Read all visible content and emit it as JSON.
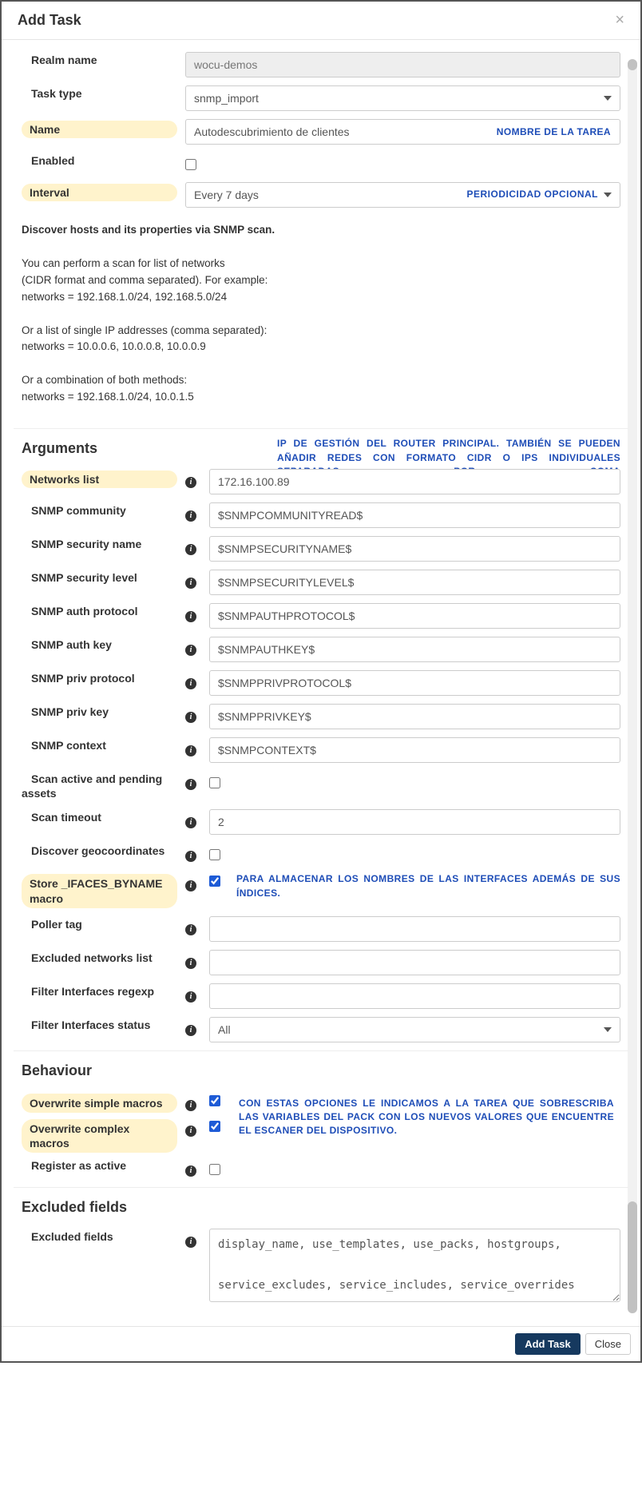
{
  "modal": {
    "title": "Add Task",
    "close": "×"
  },
  "fields": {
    "realm_name": {
      "label": "Realm name",
      "value": "wocu-demos"
    },
    "task_type": {
      "label": "Task type",
      "value": "snmp_import"
    },
    "name": {
      "label": "Name",
      "value": "Autodescubrimiento de clientes",
      "annotation": "NOMBRE DE LA TAREA"
    },
    "enabled": {
      "label": "Enabled"
    },
    "interval": {
      "label": "Interval",
      "value": "Every 7 days",
      "annotation": "PERIODICIDAD OPCIONAL"
    }
  },
  "description": {
    "heading": "Discover hosts and its properties via SNMP scan.",
    "p1a": "You can perform a scan for list of networks",
    "p1b": "(CIDR format and comma separated). For example:",
    "p1c": "networks = 192.168.1.0/24, 192.168.5.0/24",
    "p2a": "Or a list of single IP addresses (comma separated):",
    "p2b": "networks = 10.0.0.6, 10.0.0.8, 10.0.0.9",
    "p3a": "Or a combination of both methods:",
    "p3b": "networks = 192.168.1.0/24, 10.0.1.5"
  },
  "sections": {
    "arguments": "Arguments",
    "behaviour": "Behaviour",
    "excluded": "Excluded fields"
  },
  "annotations": {
    "networks": "IP DE GESTIÓN DEL ROUTER PRINCIPAL. TAMBIÉN SE PUEDEN AÑADIR REDES CON FORMATO CIDR O IPS INDIVIDUALES SEPARADAS POR COMA",
    "ifaces": "PARA ALMACENAR LOS NOMBRES DE LAS INTERFACES ADEMÁS DE SUS ÍNDICES.",
    "overwrite": "CON ESTAS OPCIONES LE INDICAMOS A LA TAREA QUE SOBRESCRIBA LAS VARIABLES DEL PACK CON LOS NUEVOS VALORES QUE ENCUENTRE  EL ESCANER DEL DISPOSITIVO."
  },
  "args": {
    "networks_list": {
      "label": "Networks list",
      "value": "172.16.100.89"
    },
    "snmp_community": {
      "label": "SNMP community",
      "value": "$SNMPCOMMUNITYREAD$"
    },
    "snmp_sec_name": {
      "label": "SNMP security name",
      "value": "$SNMPSECURITYNAME$"
    },
    "snmp_sec_level": {
      "label": "SNMP security level",
      "value": "$SNMPSECURITYLEVEL$"
    },
    "snmp_auth_proto": {
      "label": "SNMP auth protocol",
      "value": "$SNMPAUTHPROTOCOL$"
    },
    "snmp_auth_key": {
      "label": "SNMP auth key",
      "value": "$SNMPAUTHKEY$"
    },
    "snmp_priv_proto": {
      "label": "SNMP priv protocol",
      "value": "$SNMPPRIVPROTOCOL$"
    },
    "snmp_priv_key": {
      "label": "SNMP priv key",
      "value": "$SNMPPRIVKEY$"
    },
    "snmp_context": {
      "label": "SNMP context",
      "value": "$SNMPCONTEXT$"
    },
    "scan_active": {
      "label": "Scan active and pending assets"
    },
    "scan_timeout": {
      "label": "Scan timeout",
      "value": "2"
    },
    "discover_geo": {
      "label": "Discover geocoordinates"
    },
    "store_ifaces": {
      "label": "Store _IFACES_BYNAME macro"
    },
    "poller_tag": {
      "label": "Poller tag",
      "value": ""
    },
    "excluded_networks": {
      "label": "Excluded networks list",
      "value": ""
    },
    "filter_regexp": {
      "label": "Filter Interfaces regexp",
      "value": ""
    },
    "filter_status": {
      "label": "Filter Interfaces status",
      "value": "All"
    }
  },
  "behaviour": {
    "overwrite_simple": {
      "label": "Overwrite simple macros"
    },
    "overwrite_complex": {
      "label": "Overwrite complex macros"
    },
    "register_active": {
      "label": "Register as active"
    }
  },
  "excluded": {
    "label": "Excluded fields",
    "value": "display_name, use_templates, use_packs, hostgroups,\n\nservice_excludes, service_includes, service_overrides"
  },
  "footer": {
    "add": "Add Task",
    "close": "Close"
  }
}
